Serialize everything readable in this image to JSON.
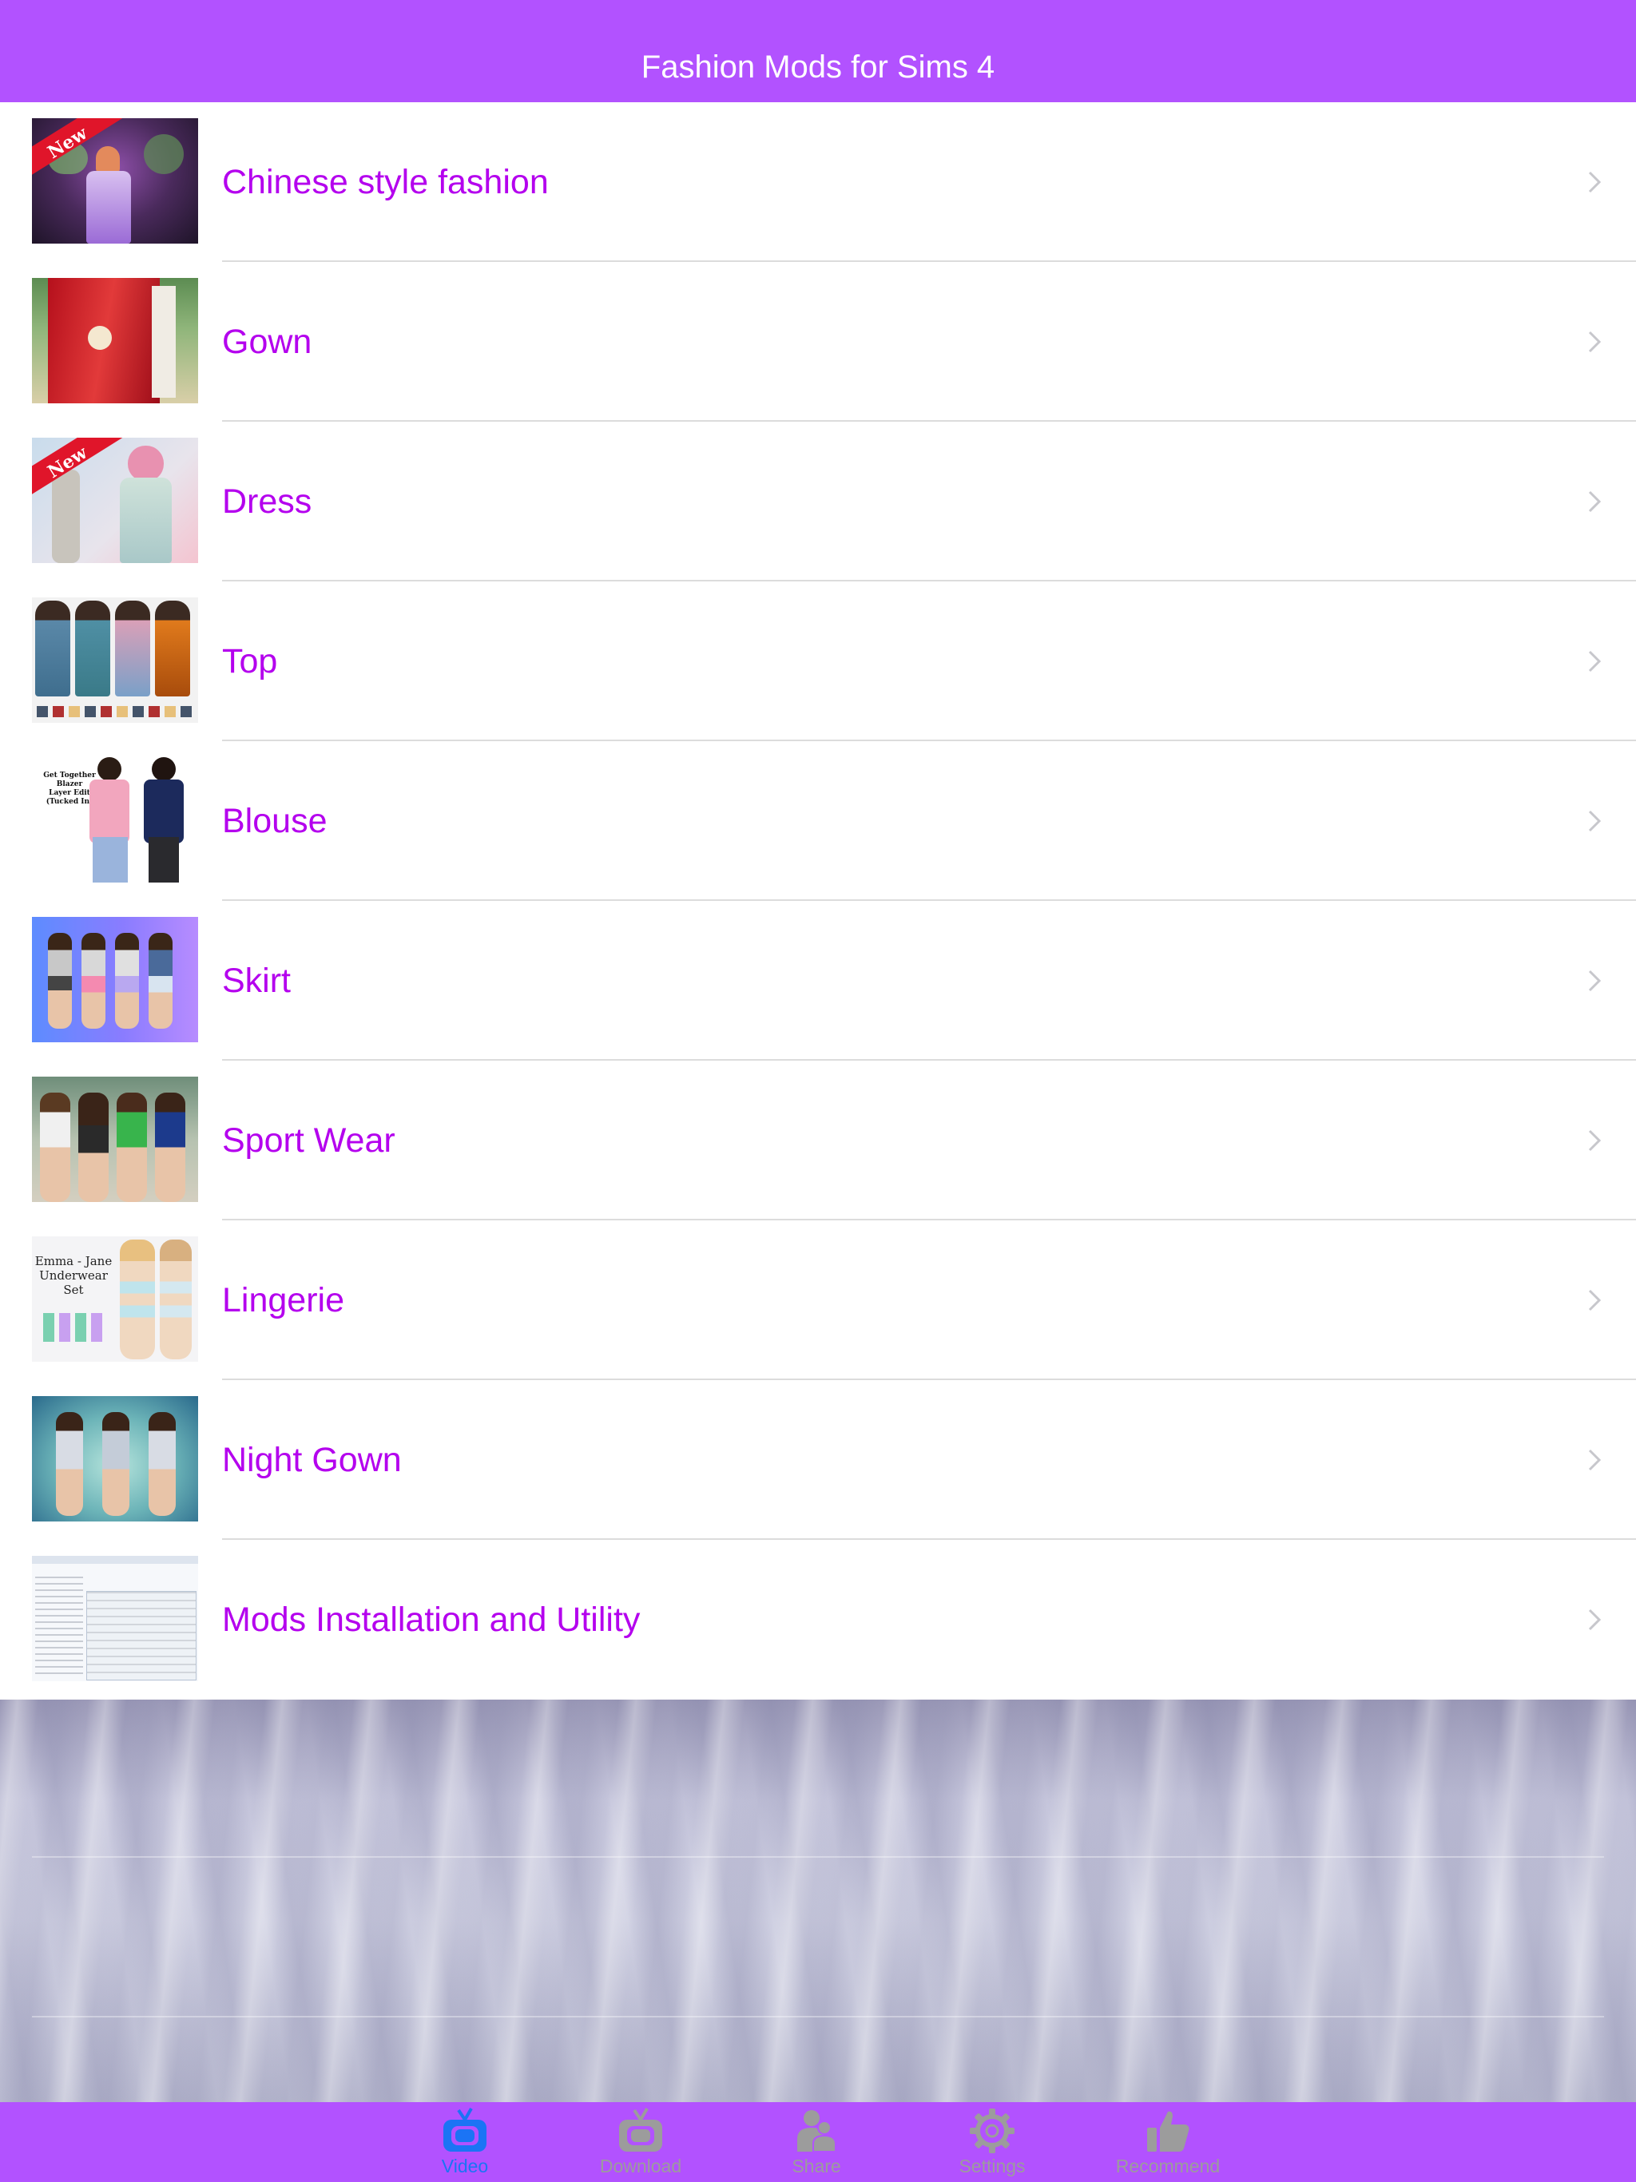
{
  "header": {
    "title": "Fashion Mods for Sims 4"
  },
  "categories": [
    {
      "label": "Chinese style fashion",
      "thumbnail": "chinese-style-thumbnail",
      "badge": "New"
    },
    {
      "label": "Gown",
      "thumbnail": "gown-thumbnail"
    },
    {
      "label": "Dress",
      "thumbnail": "dress-thumbnail",
      "badge": "New"
    },
    {
      "label": "Top",
      "thumbnail": "top-thumbnail"
    },
    {
      "label": "Blouse",
      "thumbnail": "blouse-thumbnail",
      "thumb_text": [
        "Get Together",
        "Blazer",
        "Layer Edit",
        "(Tucked In)"
      ]
    },
    {
      "label": "Skirt",
      "thumbnail": "skirt-thumbnail"
    },
    {
      "label": "Sport Wear",
      "thumbnail": "sport-wear-thumbnail"
    },
    {
      "label": "Lingerie",
      "thumbnail": "lingerie-thumbnail",
      "thumb_text": [
        "Emma - Jane",
        "Underwear",
        "Set"
      ]
    },
    {
      "label": "Night Gown",
      "thumbnail": "night-gown-thumbnail"
    },
    {
      "label": "Mods Installation and Utility",
      "thumbnail": "mods-installation-thumbnail"
    }
  ],
  "tab_bar": {
    "tabs": [
      {
        "label": "Video",
        "icon": "tv-icon",
        "active": true
      },
      {
        "label": "Download",
        "icon": "tv-icon",
        "active": false
      },
      {
        "label": "Share",
        "icon": "people-icon",
        "active": false
      },
      {
        "label": "Settings",
        "icon": "gear-icon",
        "active": false
      },
      {
        "label": "Recommend",
        "icon": "thumbs-up-icon",
        "active": false
      }
    ]
  },
  "colors": {
    "accent": "#b252ff",
    "row_text": "#b400ee",
    "active_tab": "#1b74f5",
    "inactive_tab": "#9c9c9c"
  }
}
